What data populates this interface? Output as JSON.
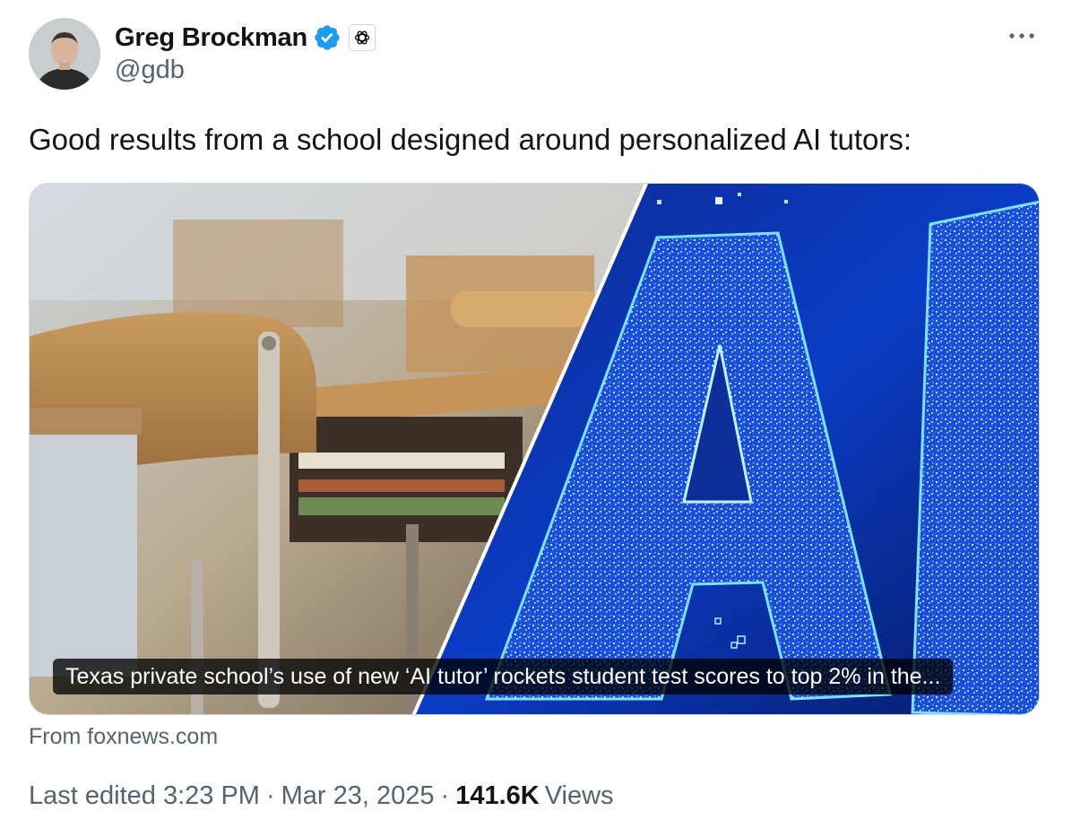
{
  "author": {
    "display_name": "Greg Brockman",
    "handle": "@gdb",
    "avatar_icon": "person-avatar",
    "verified_icon": "verified-badge-icon",
    "affiliate_icon": "openai-logo-icon"
  },
  "more_icon": "more-options-icon",
  "tweet": {
    "text": "Good results from a school designed around personalized AI tutors:"
  },
  "card": {
    "headline": "Texas private school’s use of new ‘AI tutor’ rockets student test scores to top 2% in the...",
    "image_text": "AI",
    "source": "From foxnews.com"
  },
  "meta": {
    "edited": "Last edited 3:23 PM",
    "separator": "·",
    "date": "Mar 23, 2025",
    "views_count": "141.6K",
    "views_label": "Views"
  },
  "colors": {
    "text_primary": "#0f1419",
    "text_secondary": "#536471",
    "verified_blue": "#1d9bf0",
    "border": "#cfd9de"
  }
}
